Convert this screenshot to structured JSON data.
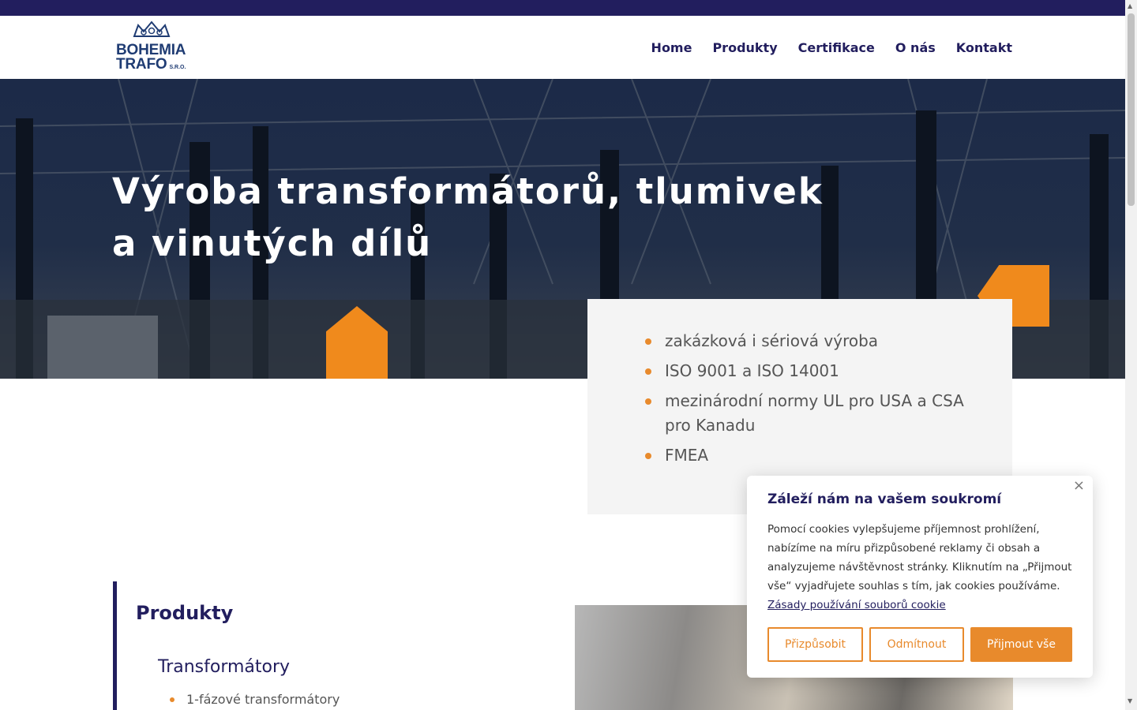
{
  "logo": {
    "line1": "BOHEMIA",
    "line2": "TRAFO",
    "suffix": "S.R.O.",
    "brand_color": "#1f3c73"
  },
  "nav": {
    "items": [
      "Home",
      "Produkty",
      "Certifikace",
      "O nás",
      "Kontakt"
    ]
  },
  "hero": {
    "title_line1": "Výroba transformátorů, tlumivek",
    "title_line2": "a vinutých dílů"
  },
  "features": {
    "items": [
      "zakázková i sériová výroba",
      "ISO 9001 a ISO 14001",
      "mezinárodní normy UL pro USA a CSA pro Kanadu",
      "FMEA"
    ]
  },
  "products": {
    "title": "Produkty",
    "subtitle": "Transformátory",
    "items": [
      "1-fázové transformátory"
    ]
  },
  "cookie": {
    "close": "×",
    "title": "Záleží nám na vašem soukromí",
    "text": "Pomocí cookies vylepšujeme příjemnost prohlížení, nabízíme na míru přizpůsobené reklamy či obsah a analyzujeme návštěvnost stránky. Kliknutím na „Přijmout vše“ vyjadřujete souhlas s tím, jak cookies používáme. ",
    "link": "Zásady používání souborů cookie",
    "btn_customize": "Přizpůsobit",
    "btn_reject": "Odmítnout",
    "btn_accept": "Přijmout vše"
  },
  "colors": {
    "navy": "#221e5e",
    "accent": "#f08a1c",
    "panel": "#f4f4f4"
  },
  "icons": {
    "close": "close-icon",
    "crown": "crown-logo-icon"
  }
}
